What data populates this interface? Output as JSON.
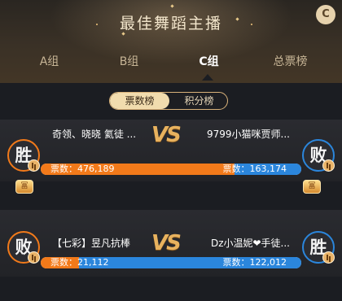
{
  "header": {
    "title": "最佳舞蹈主播",
    "close_label": "C"
  },
  "tabs": [
    {
      "label": "A组",
      "active": false
    },
    {
      "label": "B组",
      "active": false
    },
    {
      "label": "C组",
      "active": true
    },
    {
      "label": "总票榜",
      "active": false
    }
  ],
  "toggle": {
    "options": [
      {
        "label": "票数榜",
        "active": true
      },
      {
        "label": "积分榜",
        "active": false
      }
    ]
  },
  "matches": [
    {
      "left_name": "奇领、晓晓 氦徒 ...",
      "right_name": "9799小猫咪贾师...",
      "left_votes": "票数：476,189",
      "right_votes": "票数：163,174",
      "left_result": "胜",
      "right_result": "败",
      "left_share": 0.745,
      "left_color": "#f27a1a",
      "right_color": "#2b86dc",
      "left_ring": "#f27a1a",
      "right_ring": "#2b86dc",
      "left_crown": "冨",
      "right_crown": "冨"
    },
    {
      "left_name": "【七彩】昱凡抗棒",
      "right_name": "Dz小温妮❤手徒...",
      "left_votes": "票数：21,112",
      "right_votes": "票数：122,012",
      "left_result": "败",
      "right_result": "胜",
      "left_share": 0.147,
      "left_color": "#f27a1a",
      "right_color": "#2b86dc",
      "left_ring": "#f27a1a",
      "right_ring": "#2b86dc"
    }
  ],
  "vs_label": "VS"
}
